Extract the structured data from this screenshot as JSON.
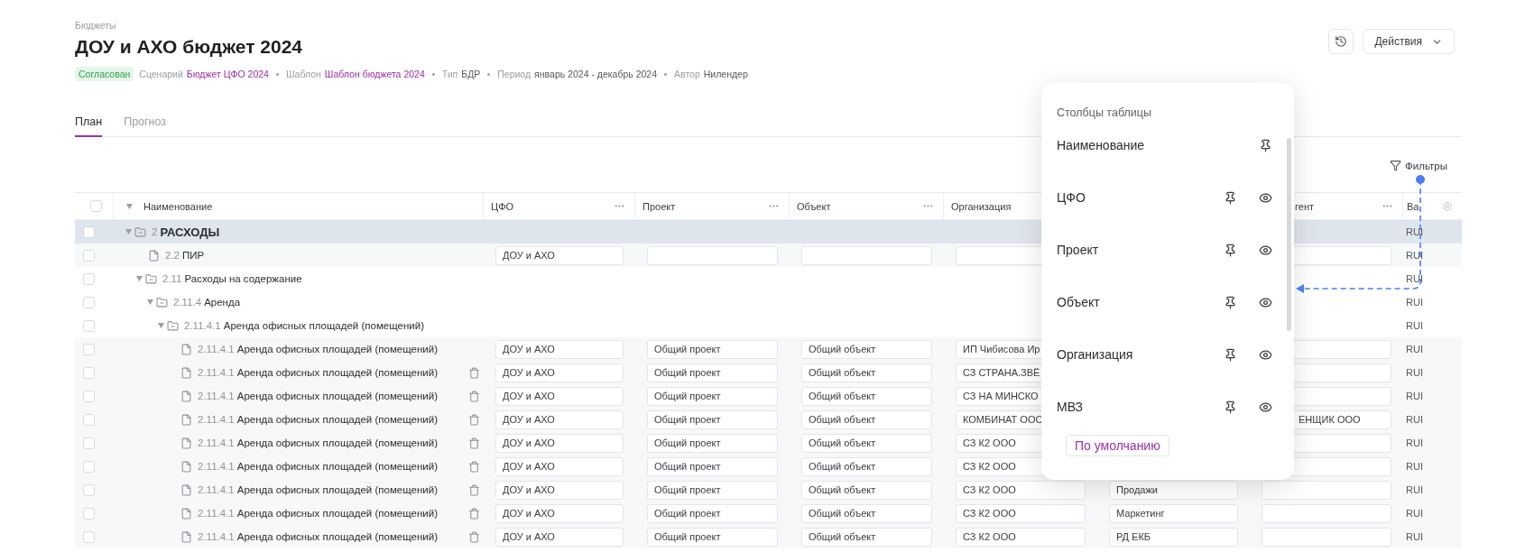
{
  "breadcrumb": "Бюджеты",
  "title": "ДОУ и АХО бюджет 2024",
  "status": {
    "label": "Согласован",
    "color": "#2e9e4f"
  },
  "meta": [
    {
      "label": "Сценарий",
      "value": "Бюджет ЦФО 2024",
      "link": true
    },
    {
      "label": "Шаблон",
      "value": "Шаблон бюджета 2024",
      "link": true
    },
    {
      "label": "Тип",
      "value": "БДР",
      "link": false
    },
    {
      "label": "Период",
      "value": "январь 2024 - декабрь 2024",
      "link": false
    },
    {
      "label": "Автор",
      "value": "Нилендер",
      "link": false
    }
  ],
  "actions_button": "Действия",
  "tabs": [
    {
      "label": "План",
      "selected": true
    },
    {
      "label": "Прогноз",
      "selected": false
    }
  ],
  "filters_button": "Фильтры",
  "columns": {
    "name": "Наименование",
    "cfo": "ЦФО",
    "project": "Проект",
    "object": "Объект",
    "organization": "Организация",
    "column_7": "гент",
    "column_8": "Ва"
  },
  "all_checked": false,
  "rows": [
    {
      "kind": "folder",
      "checked": false,
      "code": "2",
      "name": "РАСХОДЫ",
      "expanded": true,
      "selected": true,
      "currency": "RUI",
      "children": [
        {
          "kind": "file",
          "checked": false,
          "code": "2.2",
          "name": "ПИР",
          "selected": false,
          "deletable": false,
          "currency": "RUI",
          "cells": {
            "cfo": "ДОУ и АХО"
          }
        },
        {
          "kind": "folder",
          "checked": false,
          "code": "2.11",
          "name": "Расходы на содержание",
          "expanded": true,
          "selected": false,
          "currency": "RUI",
          "children": [
            {
              "kind": "folder",
              "checked": false,
              "code": "2.11.4",
              "name": "Аренда",
              "expanded": true,
              "selected": false,
              "currency": "RUI",
              "children": [
                {
                  "kind": "folder",
                  "checked": false,
                  "code": "2.11.4.1",
                  "name": "Аренда офисных площадей (помещений)",
                  "expanded": true,
                  "selected": false,
                  "currency": "RUI",
                  "children": [
                    {
                      "kind": "file",
                      "code": "2.11.4.1",
                      "name": "Аренда офисных площадей (помещений)",
                      "selected": false,
                      "checked": false,
                      "deletable": false,
                      "currency": "RUI",
                      "cells": {
                        "cfo": "ДОУ и АХО",
                        "project": "Общий проект",
                        "object": "Общий объект",
                        "organization": "ИП Чибисова Ир"
                      }
                    },
                    {
                      "kind": "file",
                      "code": "2.11.4.1",
                      "name": "Аренда офисных площадей (помещений)",
                      "selected": false,
                      "deletable": true,
                      "currency": "RUI",
                      "cells": {
                        "cfo": "ДОУ и АХО",
                        "project": "Общий проект",
                        "object": "Общий объект",
                        "organization": "СЗ СТРАНА.ЗВЁ"
                      },
                      "checked": false
                    },
                    {
                      "kind": "file",
                      "code": "2.11.4.1",
                      "name": "Аренда офисных площадей (помещений)",
                      "selected": false,
                      "deletable": true,
                      "currency": "RUI",
                      "cells": {
                        "cfo": "ДОУ и АХО",
                        "project": "Общий проект",
                        "object": "Общий объект",
                        "organization": "СЗ НА МИНСКО"
                      },
                      "checked": false
                    },
                    {
                      "kind": "file",
                      "code": "2.11.4.1",
                      "name": "Аренда офисных площадей (помещений)",
                      "selected": false,
                      "deletable": true,
                      "currency": "RUI",
                      "cells": {
                        "cfo": "ДОУ и АХО",
                        "project": "Общий проект",
                        "object": "Общий объект",
                        "organization": "КОМБИНАТ ООС",
                        "contractor": "ЕНЩИК ООО"
                      },
                      "checked": false
                    },
                    {
                      "kind": "file",
                      "code": "2.11.4.1",
                      "name": "Аренда офисных площадей (помещений)",
                      "selected": false,
                      "deletable": true,
                      "currency": "RUI",
                      "cells": {
                        "cfo": "ДОУ и АХО",
                        "project": "Общий проект",
                        "object": "Общий объект",
                        "organization": "СЗ К2 ООО"
                      },
                      "checked": false
                    },
                    {
                      "kind": "file",
                      "code": "2.11.4.1",
                      "name": "Аренда офисных площадей (помещений)",
                      "selected": false,
                      "deletable": true,
                      "currency": "RUI",
                      "cells": {
                        "cfo": "ДОУ и АХО",
                        "project": "Общий проект",
                        "object": "Общий объект",
                        "organization": "СЗ К2 ООО"
                      },
                      "checked": false
                    },
                    {
                      "kind": "file",
                      "code": "2.11.4.1",
                      "name": "Аренда офисных площадей (помещений)",
                      "selected": false,
                      "deletable": true,
                      "currency": "RUI",
                      "cells": {
                        "cfo": "ДОУ и АХО",
                        "project": "Общий проект",
                        "object": "Общий объект",
                        "organization": "СЗ К2 ООО",
                        "mvz": "Продажи"
                      },
                      "checked": false
                    },
                    {
                      "kind": "file",
                      "code": "2.11.4.1",
                      "name": "Аренда офисных площадей (помещений)",
                      "selected": false,
                      "deletable": true,
                      "currency": "RUI",
                      "cells": {
                        "cfo": "ДОУ и АХО",
                        "project": "Общий проект",
                        "object": "Общий объект",
                        "organization": "СЗ К2 ООО",
                        "mvz": "Маркетинг"
                      },
                      "checked": false
                    },
                    {
                      "kind": "file",
                      "code": "2.11.4.1",
                      "name": "Аренда офисных площадей (помещений)",
                      "selected": false,
                      "deletable": true,
                      "currency": "RUI",
                      "cells": {
                        "cfo": "ДОУ и АХО",
                        "project": "Общий проект",
                        "object": "Общий объект",
                        "organization": "СЗ К2 ООО",
                        "mvz": "РД ЕКБ"
                      },
                      "checked": false
                    }
                  ]
                }
              ]
            }
          ]
        }
      ]
    }
  ],
  "column_menu": {
    "title": "Столбцы таблицы",
    "items": [
      {
        "label": "Наименование",
        "can_hide": false
      },
      {
        "label": "ЦФО",
        "can_hide": true
      },
      {
        "label": "Проект",
        "can_hide": true
      },
      {
        "label": "Объект",
        "can_hide": true
      },
      {
        "label": "Организация",
        "can_hide": true
      },
      {
        "label": "МВЗ",
        "can_hide": true
      }
    ],
    "reset_button": "По умолчанию"
  }
}
